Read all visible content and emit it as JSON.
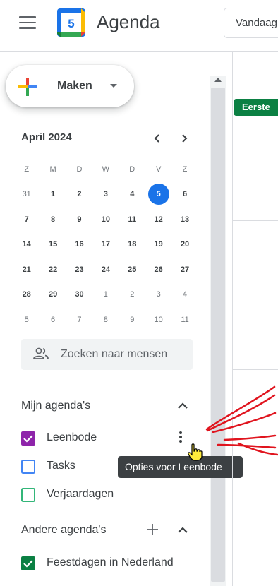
{
  "header": {
    "logo_day": "5",
    "app_title": "Agenda",
    "today_button": "Vandaag"
  },
  "sidebar": {
    "create_label": "Maken",
    "month_title": "April 2024",
    "prev_month_icon": "chevron-left-icon",
    "next_month_icon": "chevron-right-icon",
    "weekdays": [
      "Z",
      "M",
      "D",
      "W",
      "D",
      "V",
      "Z"
    ],
    "weeks": [
      [
        "31",
        "1",
        "2",
        "3",
        "4",
        "5",
        "6"
      ],
      [
        "7",
        "8",
        "9",
        "10",
        "11",
        "12",
        "13"
      ],
      [
        "14",
        "15",
        "16",
        "17",
        "18",
        "19",
        "20"
      ],
      [
        "21",
        "22",
        "23",
        "24",
        "25",
        "26",
        "27"
      ],
      [
        "28",
        "29",
        "30",
        "1",
        "2",
        "3",
        "4"
      ],
      [
        "5",
        "6",
        "7",
        "8",
        "9",
        "10",
        "11"
      ]
    ],
    "today": "5",
    "search_people_placeholder": "Zoeken naar mensen",
    "my_calendars": {
      "title": "Mijn agenda's",
      "items": [
        {
          "label": "Leenbode",
          "checked": true,
          "color": "#8e24aa"
        },
        {
          "label": "Tasks",
          "checked": false,
          "color": "#4285f4"
        },
        {
          "label": "Verjaardagen",
          "checked": false,
          "color": "#33b679"
        }
      ]
    },
    "other_calendars": {
      "title": "Andere agenda's",
      "items": [
        {
          "label": "Feestdagen in Nederland",
          "checked": true,
          "color": "#0b8043"
        }
      ]
    },
    "tooltip": "Opties voor Leenbode"
  },
  "main": {
    "event_label": "Eerste"
  },
  "colors": {
    "accent": "#1a73e8",
    "event_green": "#0b8043",
    "annotation_red": "#e0141e",
    "cursor_yellow": "#ffeb3b"
  }
}
